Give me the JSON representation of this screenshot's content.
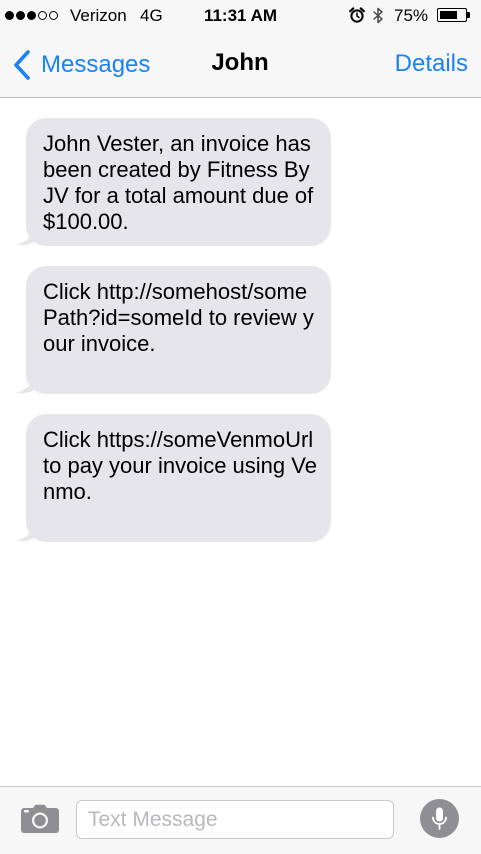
{
  "status_bar": {
    "carrier": "Verizon",
    "network": "4G",
    "time": "11:31 AM",
    "battery_percent": "75%",
    "battery_level": 0.75,
    "signal_strength": 3,
    "signal_total": 5,
    "icons": [
      "signal-dots-icon",
      "alarm-clock-icon",
      "bluetooth-icon",
      "battery-icon"
    ]
  },
  "nav": {
    "back_label": "Messages",
    "title": "John",
    "details_label": "Details"
  },
  "messages": [
    {
      "direction": "incoming",
      "text": "John Vester, an invoice has been created by Fitness By JV for a total amount due of $100.00."
    },
    {
      "direction": "incoming",
      "text": "Click http://somehost/somePath?id=someId to review your invoice."
    },
    {
      "direction": "incoming",
      "text": "Click https://someVenmoUrl to pay your invoice using Venmo."
    }
  ],
  "input_bar": {
    "placeholder": "Text Message",
    "value": "",
    "icons": [
      "camera-icon",
      "microphone-icon"
    ]
  },
  "colors": {
    "accent": "#1a82f7",
    "incoming_bubble": "#e5e5ea",
    "bar_background": "#f7f7f8",
    "mic_button": "#8e8e93"
  }
}
